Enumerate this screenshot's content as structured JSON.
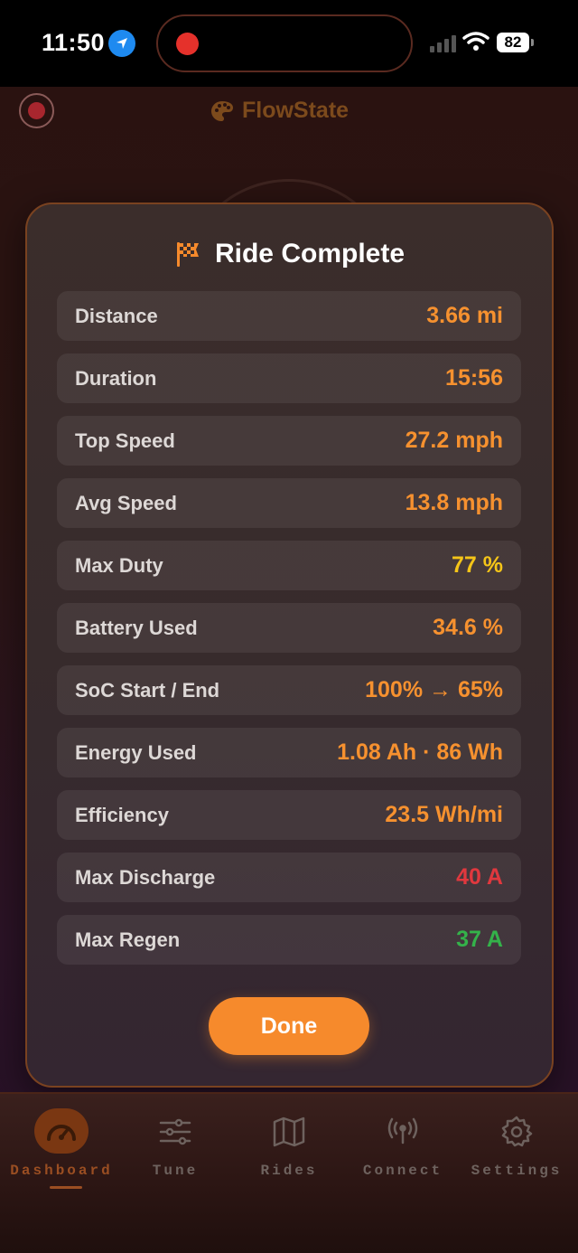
{
  "status_bar": {
    "time": "11:50",
    "battery": "82"
  },
  "header": {
    "app_name": "FlowState"
  },
  "modal": {
    "title": "Ride Complete",
    "stats": [
      {
        "label": "Distance",
        "value": "3.66 mi",
        "color": "#f6912f"
      },
      {
        "label": "Duration",
        "value": "15:56",
        "color": "#f6912f"
      },
      {
        "label": "Top Speed",
        "value": "27.2 mph",
        "color": "#f6912f"
      },
      {
        "label": "Avg Speed",
        "value": "13.8 mph",
        "color": "#f6912f"
      },
      {
        "label": "Max Duty",
        "value": "77 %",
        "color": "#f5c518"
      },
      {
        "label": "Battery Used",
        "value": "34.6 %",
        "color": "#f6912f"
      },
      {
        "label": "SoC Start / End",
        "value": "100% → 65%",
        "color": "#f6912f"
      },
      {
        "label": "Energy Used",
        "value": "1.08 Ah · 86 Wh",
        "color": "#f6912f"
      },
      {
        "label": "Efficiency",
        "value": "23.5 Wh/mi",
        "color": "#f6912f"
      },
      {
        "label": "Max Discharge",
        "value": "40 A",
        "color": "#e0383e"
      },
      {
        "label": "Max Regen",
        "value": "37 A",
        "color": "#34b24a"
      }
    ],
    "done_label": "Done"
  },
  "tabs": [
    {
      "label": "Dashboard",
      "icon": "speedometer-icon",
      "active": true
    },
    {
      "label": "Tune",
      "icon": "sliders-icon",
      "active": false
    },
    {
      "label": "Rides",
      "icon": "map-icon",
      "active": false
    },
    {
      "label": "Connect",
      "icon": "antenna-icon",
      "active": false
    },
    {
      "label": "Settings",
      "icon": "gear-icon",
      "active": false
    }
  ],
  "colors": {
    "accent": "#f68a2c",
    "warning": "#f5c518",
    "danger": "#e0383e",
    "success": "#34b24a"
  }
}
